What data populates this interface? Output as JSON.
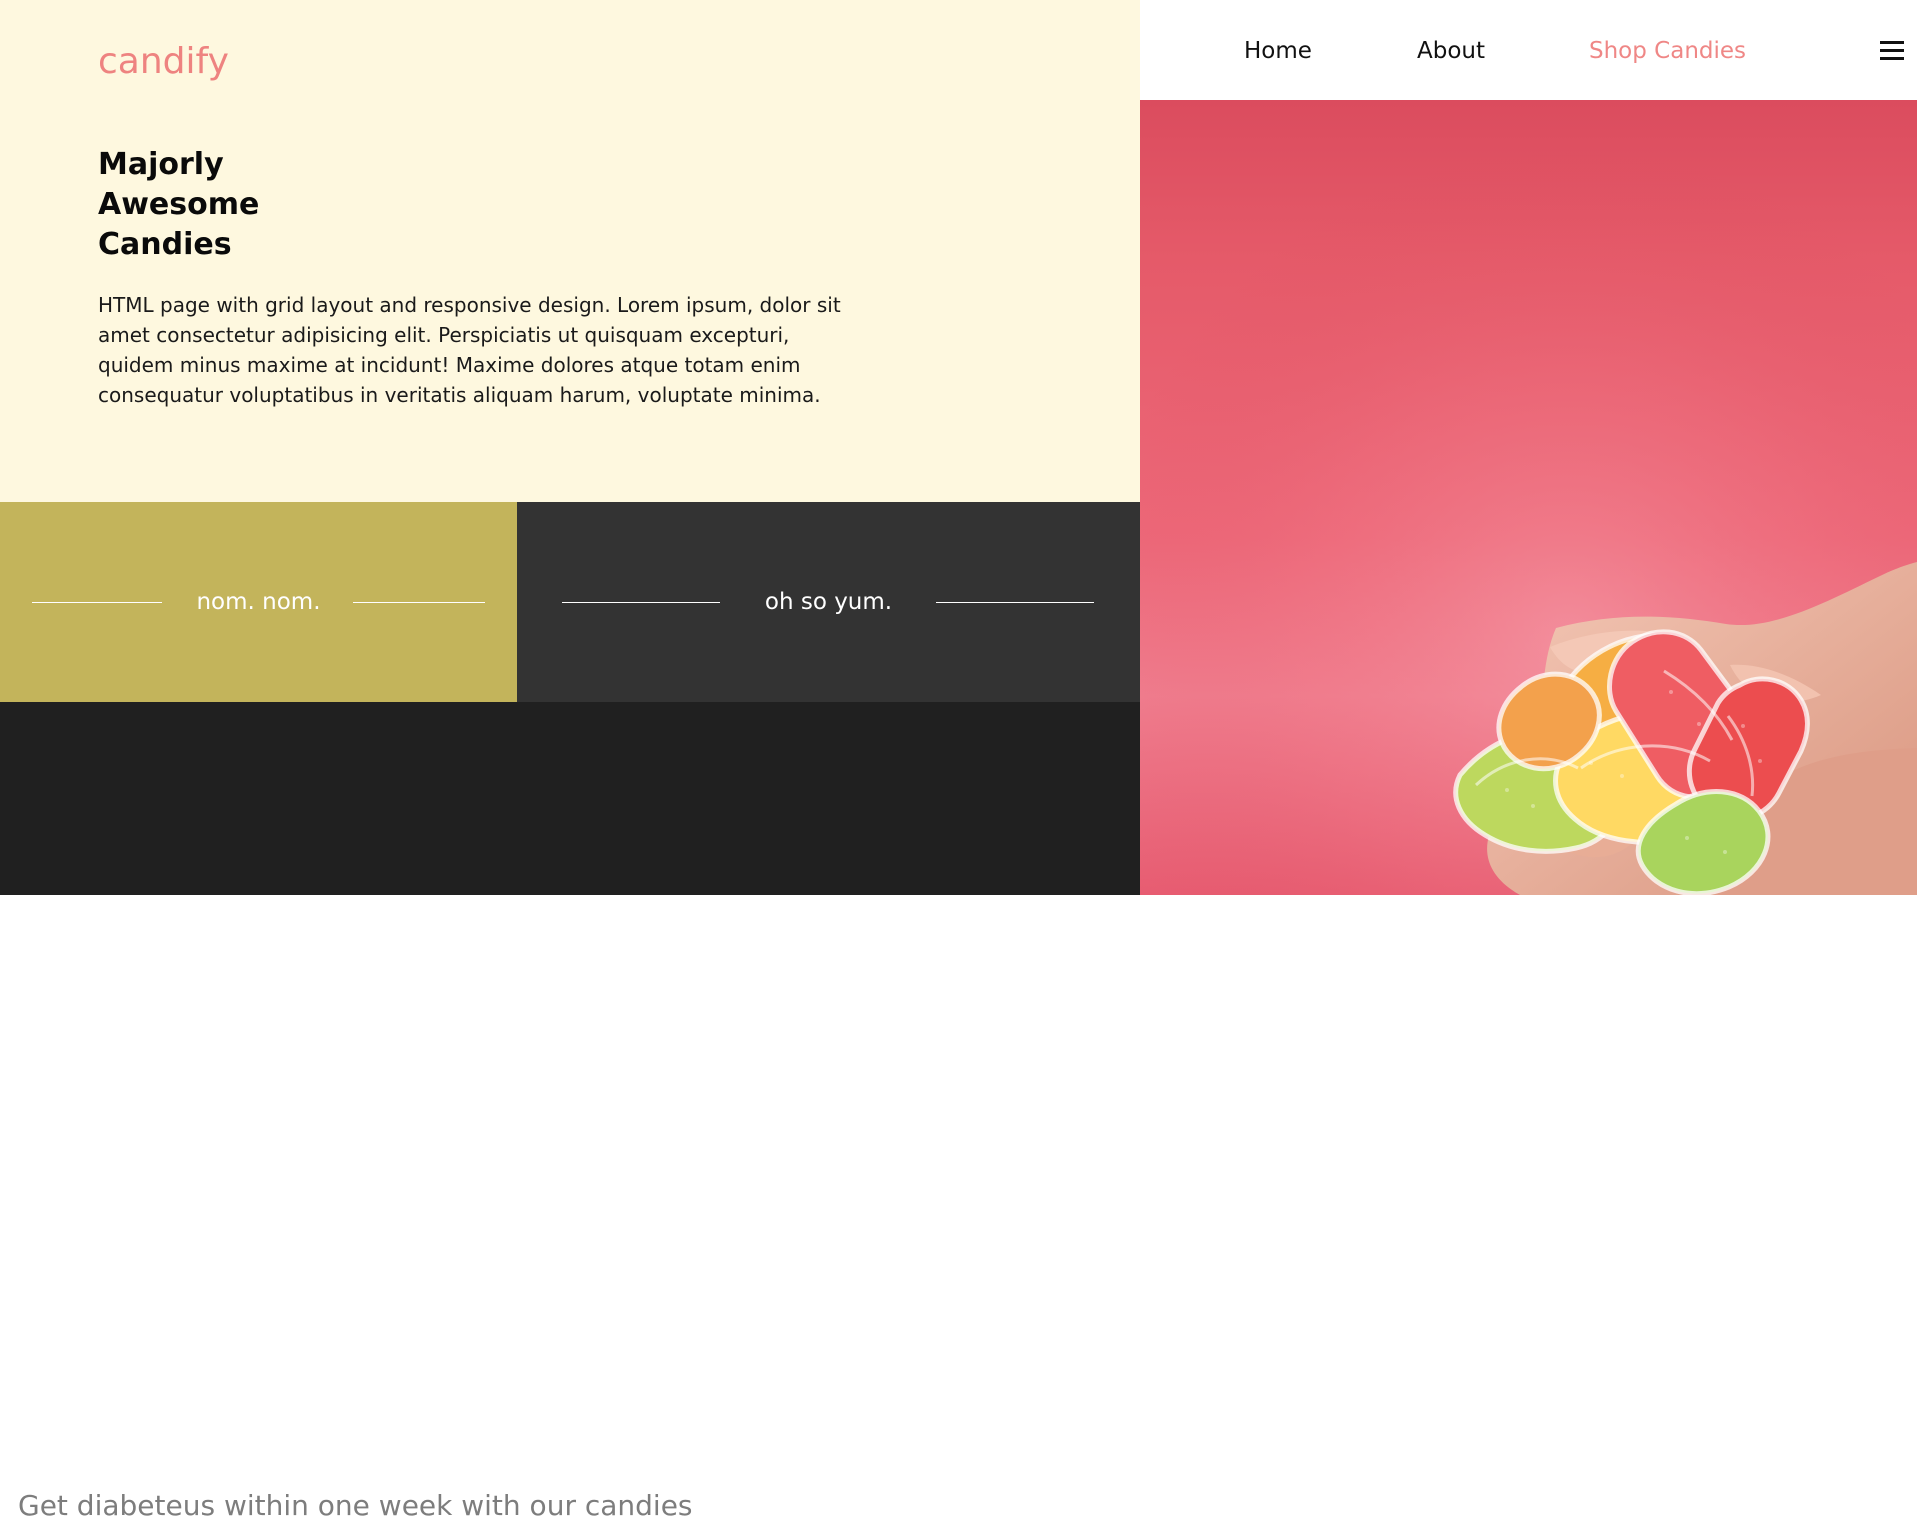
{
  "brand": {
    "logo": "candify"
  },
  "hero": {
    "headline": "Majorly Awesome Candies",
    "description": "HTML page with grid layout and responsive design. Lorem ipsum, dolor sit amet consectetur adipisicing elit. Perspiciatis ut quisquam excepturi, quidem minus maxime at incidunt! Maxime dolores atque totam enim consequatur voluptatibus in veritatis aliquam harum, voluptate minima."
  },
  "bands": {
    "gold": {
      "label": "nom. nom."
    },
    "dark": {
      "label": "oh so yum."
    }
  },
  "footer": {
    "tagline": "Get diabeteus within one week with our candies"
  },
  "nav": {
    "items": [
      {
        "label": "Home"
      },
      {
        "label": "About"
      },
      {
        "label": "Shop Candies"
      }
    ],
    "menu_icon": "hamburger-menu-icon"
  },
  "photo": {
    "alt": "hand holding colorful jelly candies"
  },
  "colors": {
    "hero_background": "#fef8df",
    "logo": "#ee8380",
    "gold_band": "#c3b45b",
    "dark_band": "#333333",
    "footer_band": "#202020",
    "active_nav": "#ef8786"
  }
}
